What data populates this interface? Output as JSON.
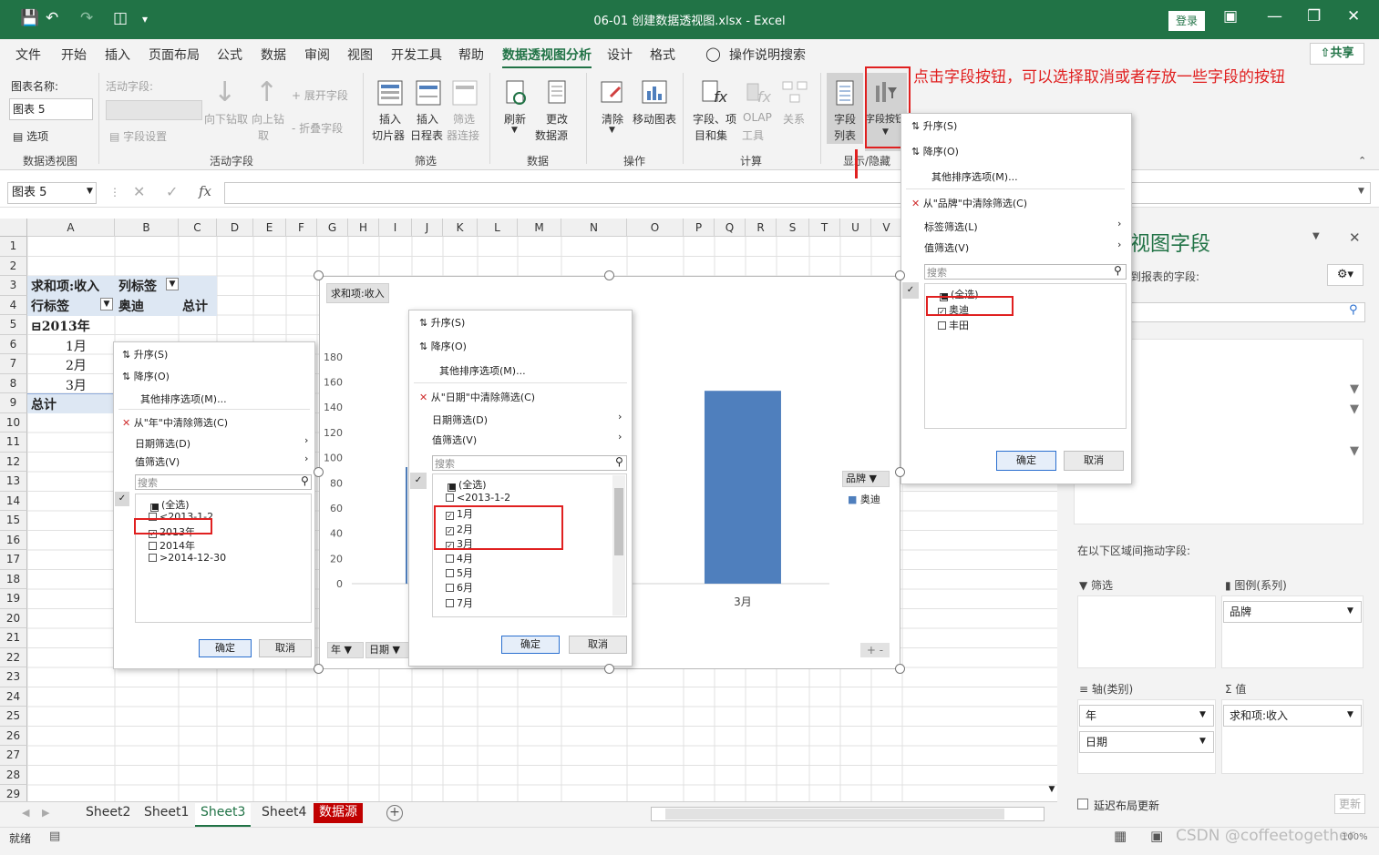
{
  "window": {
    "title": "06-01 创建数据透视图.xlsx  -  Excel",
    "login_label": "登录"
  },
  "menu": {
    "items": [
      "文件",
      "开始",
      "插入",
      "页面布局",
      "公式",
      "数据",
      "审阅",
      "视图",
      "开发工具",
      "帮助",
      "数据透视图分析",
      "设计",
      "格式"
    ],
    "active": "数据透视图分析",
    "tell_me": "操作说明搜索",
    "share": "共享"
  },
  "ribbon": {
    "chart_name_label": "图表名称:",
    "chart_name_value": "图表 5",
    "options_label": "选项",
    "group_pivot": "数据透视图",
    "active_field_label": "活动字段:",
    "field_settings": "字段设置",
    "drill_down": "向下钻取",
    "drill_up": "向上钻",
    "drill_up2": "取",
    "expand_field": "展开字段",
    "collapse_field": "折叠字段",
    "group_active": "活动字段",
    "insert_slicer_1": "插入",
    "insert_slicer_2": "切片器",
    "insert_timeline_1": "插入",
    "insert_timeline_2": "日程表",
    "filter_conn_1": "筛选",
    "filter_conn_2": "器连接",
    "group_filter": "筛选",
    "refresh": "刷新",
    "change_source_1": "更改",
    "change_source_2": "数据源",
    "group_data": "数据",
    "clear": "清除",
    "move_chart": "移动图表",
    "group_actions": "操作",
    "fields_items_1": "字段、项",
    "fields_items_2": "目和集",
    "olap_1": "OLAP",
    "olap_2": "工具",
    "relations": "关系",
    "group_calc": "计算",
    "field_list_1": "字段",
    "field_list_2": "列表",
    "field_buttons": "字段按钮",
    "group_show": "显示/隐藏"
  },
  "annotation": "点击字段按钮，可以选择取消或者存放一些字段的按钮",
  "formula": {
    "namebox": "图表 5",
    "fx": "fx"
  },
  "columns": [
    "A",
    "B",
    "C",
    "D",
    "E",
    "F",
    "G",
    "H",
    "I",
    "J",
    "K",
    "L",
    "M",
    "N",
    "O",
    "P",
    "Q",
    "R",
    "S",
    "T",
    "U",
    "V"
  ],
  "rows": [
    "1",
    "2",
    "3",
    "4",
    "5",
    "6",
    "7",
    "8",
    "9",
    "10",
    "11",
    "12",
    "13",
    "14",
    "15",
    "16",
    "17",
    "18",
    "19",
    "20",
    "21",
    "22",
    "23",
    "24",
    "25",
    "26",
    "27",
    "28",
    "29"
  ],
  "pivot": {
    "sum_label": "求和项:收入",
    "col_label": "列标签",
    "row_label": "行标签",
    "brand": "奥迪",
    "total": "总计",
    "year": "2013年",
    "m1": "1月",
    "m2": "2月",
    "m3": "3月",
    "grand_total": "总计"
  },
  "sort_menu": {
    "asc": "升序(S)",
    "desc": "降序(O)",
    "more": "其他排序选项(M)...",
    "label_filter": "标签筛选(L)",
    "date_filter": "日期筛选(D)",
    "value_filter": "值筛选(V)",
    "search": "搜索",
    "ok": "确定",
    "cancel": "取消"
  },
  "popup_year": {
    "clear": "从\"年\"中清除筛选(C)",
    "items": [
      {
        "label": "(全选)",
        "state": "partial"
      },
      {
        "label": "<2013-1-2",
        "state": "off"
      },
      {
        "label": "2013年",
        "state": "on"
      },
      {
        "label": "2014年",
        "state": "off"
      },
      {
        "label": ">2014-12-30",
        "state": "off"
      }
    ]
  },
  "popup_date": {
    "clear": "从\"日期\"中清除筛选(C)",
    "items": [
      {
        "label": "(全选)",
        "state": "partial"
      },
      {
        "label": "<2013-1-2",
        "state": "off"
      },
      {
        "label": "1月",
        "state": "on"
      },
      {
        "label": "2月",
        "state": "on"
      },
      {
        "label": "3月",
        "state": "on"
      },
      {
        "label": "4月",
        "state": "off"
      },
      {
        "label": "5月",
        "state": "off"
      },
      {
        "label": "6月",
        "state": "off"
      },
      {
        "label": "7月",
        "state": "off"
      }
    ]
  },
  "popup_brand": {
    "clear": "从\"品牌\"中清除筛选(C)",
    "items": [
      {
        "label": "(全选)",
        "state": "partial"
      },
      {
        "label": "奥迪",
        "state": "on"
      },
      {
        "label": "丰田",
        "state": "off"
      }
    ]
  },
  "chart": {
    "field_button_value": "求和项:收入",
    "legend_field": "品牌",
    "legend_entry": "奥迪",
    "axis_btn_year": "年",
    "axis_btn_date": "日期",
    "x_label": "3月",
    "y_ticks": [
      "0",
      "20",
      "40",
      "60",
      "80",
      "100",
      "120",
      "140",
      "160",
      "180"
    ],
    "bar_color": "#4f7fbd"
  },
  "chart_data": {
    "type": "bar",
    "categories": [
      "3月"
    ],
    "series": [
      {
        "name": "奥迪",
        "values": [
          153
        ]
      }
    ],
    "ylim": [
      0,
      190
    ]
  },
  "field_panel": {
    "title": "视图字段",
    "subtitle": "到报表的字段:",
    "drag_label": "在以下区域间拖动字段:",
    "filter": "筛选",
    "legend": "图例(系列)",
    "legend_item": "品牌",
    "axis": "轴(类别)",
    "axis_items": [
      "年",
      "日期"
    ],
    "values": "值",
    "values_item": "求和项:收入",
    "defer": "延迟布局更新",
    "update": "更新"
  },
  "sheets": {
    "tabs": [
      "Sheet2",
      "Sheet1",
      "Sheet3",
      "Sheet4",
      "数据源"
    ],
    "active": "Sheet3"
  },
  "status": {
    "ready": "就绪",
    "watermark": "CSDN @coffeetogether",
    "zoom": "100%"
  },
  "colors": {
    "excel_green": "#217346",
    "highlight_red": "#e02020",
    "pivot_blue": "#dde7f3"
  }
}
